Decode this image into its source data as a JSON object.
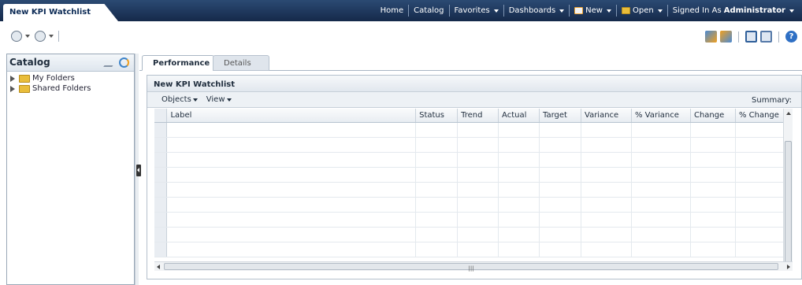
{
  "page_tab": "New KPI Watchlist",
  "global_nav": {
    "home": "Home",
    "catalog": "Catalog",
    "favorites": "Favorites",
    "dashboards": "Dashboards",
    "new": "New",
    "open": "Open",
    "signed_in_prefix": "Signed In As",
    "user": "Administrator"
  },
  "catalog_pane": {
    "title": "Catalog",
    "items": [
      {
        "label": "My Folders",
        "icon": "folder-icon"
      },
      {
        "label": "Shared Folders",
        "icon": "folder-icon"
      }
    ]
  },
  "tabs": [
    {
      "label": "Performance",
      "active": true
    },
    {
      "label": "Details",
      "active": false
    }
  ],
  "watchlist": {
    "title": "New KPI Watchlist",
    "menus": [
      "Objects",
      "View"
    ],
    "summary_label": "Summary:",
    "columns": [
      "Label",
      "Status",
      "Trend",
      "Actual",
      "Target",
      "Variance",
      "% Variance",
      "Change",
      "% Change"
    ],
    "rows": []
  },
  "colors": {
    "header_bar": "#1f3a60",
    "accent": "#2e6fc4",
    "folder": "#e9bd3a"
  }
}
